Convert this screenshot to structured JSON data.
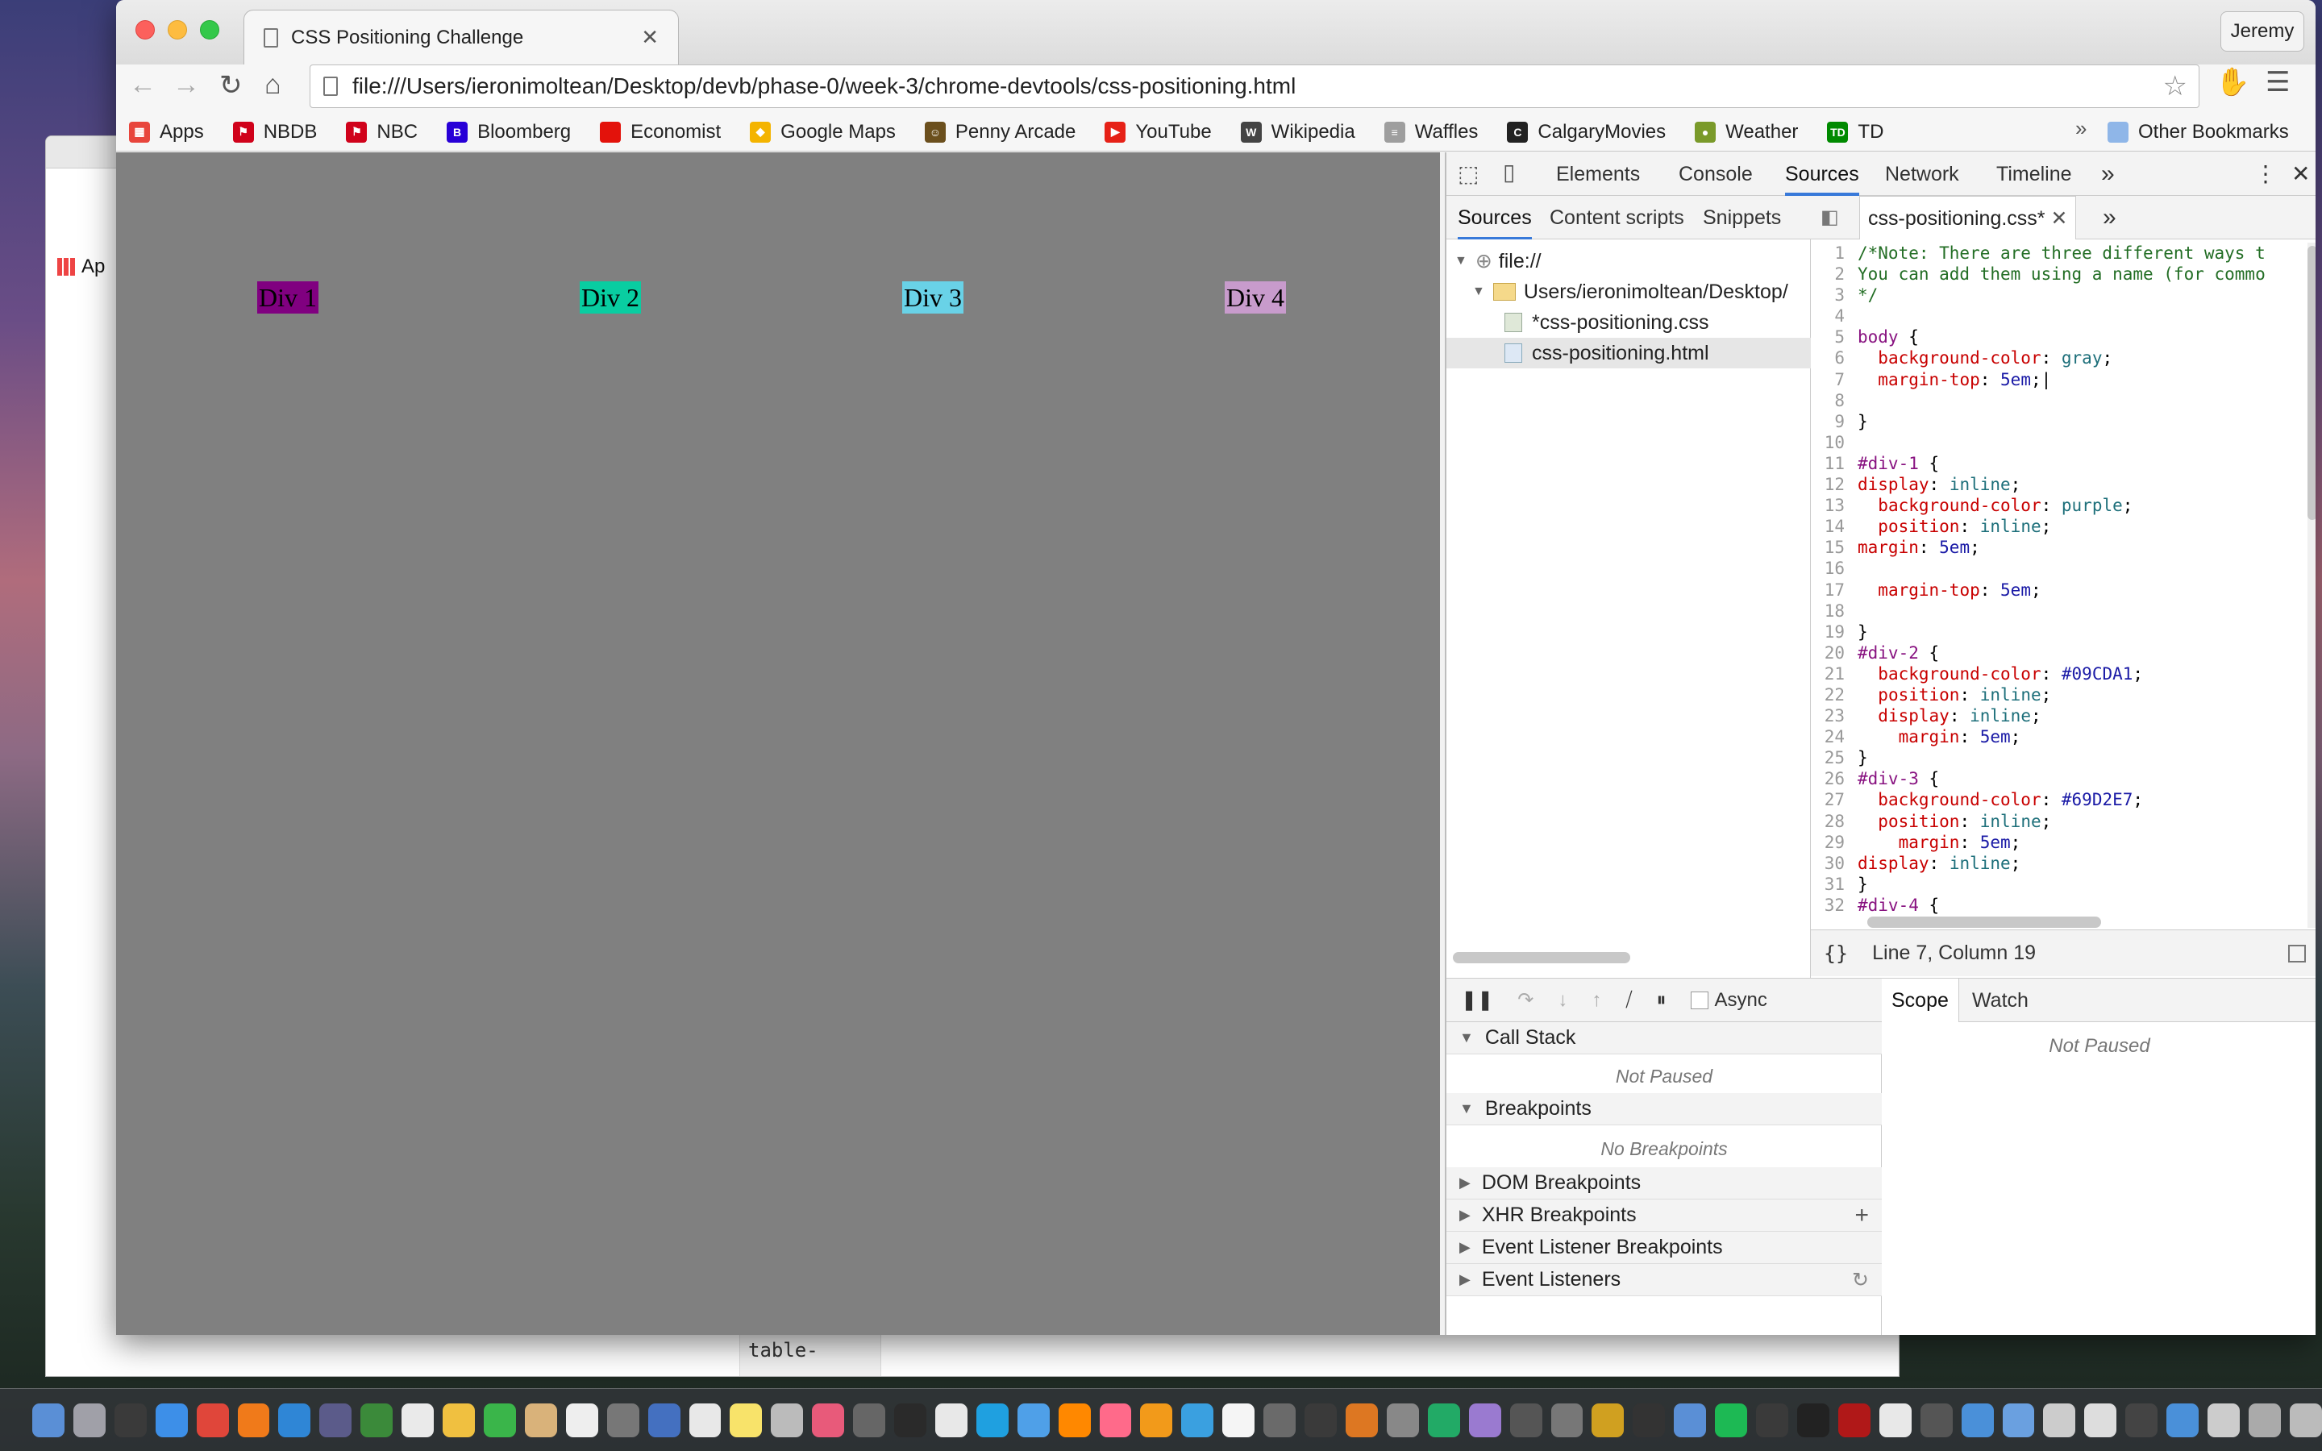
{
  "bg_window": {
    "bookmark_fragment": "Ap",
    "bottom_text": "table-"
  },
  "browser": {
    "tab_title": "CSS Positioning Challenge",
    "user": "Jeremy",
    "url": "file:///Users/ieronimoltean/Desktop/devb/phase-0/week-3/chrome-devtools/css-positioning.html",
    "bookmarks": [
      {
        "label": "Apps",
        "icon": "apps-grid-icon",
        "color": "#e8453c"
      },
      {
        "label": "NBDB",
        "icon": "flag-icon",
        "color": "#d0021b"
      },
      {
        "label": "NBC",
        "icon": "flag-icon",
        "color": "#d0021b"
      },
      {
        "label": "Bloomberg",
        "icon": "b-letter-icon",
        "color": "#2800d7"
      },
      {
        "label": "Economist",
        "icon": "square-icon",
        "color": "#e3120b"
      },
      {
        "label": "Google Maps",
        "icon": "maps-pin-icon",
        "color": "#f4b400"
      },
      {
        "label": "Penny Arcade",
        "icon": "face-icon",
        "color": "#6b4f1d"
      },
      {
        "label": "YouTube",
        "icon": "play-icon",
        "color": "#e62117"
      },
      {
        "label": "Wikipedia",
        "icon": "w-letter-icon",
        "color": "#444444"
      },
      {
        "label": "Waffles",
        "icon": "document-icon",
        "color": "#9e9e9e"
      },
      {
        "label": "CalgaryMovies",
        "icon": "c-letter-icon",
        "color": "#222222"
      },
      {
        "label": "Weather",
        "icon": "globe-icon",
        "color": "#7a9a2a"
      },
      {
        "label": "TD",
        "icon": "td-logo-icon",
        "color": "#008a00"
      }
    ],
    "bookmarks_overflow": "»",
    "other_bookmarks": "Other Bookmarks"
  },
  "page": {
    "divs": [
      {
        "label": "Div 1",
        "color": "#800080"
      },
      {
        "label": "Div 2",
        "color": "#09CDA1"
      },
      {
        "label": "Div 3",
        "color": "#69D2E7"
      },
      {
        "label": "Div 4",
        "color": "#c89bcc"
      }
    ]
  },
  "devtools": {
    "tabs": [
      "Elements",
      "Console",
      "Sources",
      "Network",
      "Timeline"
    ],
    "active_tab": "Sources",
    "more": "»",
    "nav_tabs": [
      "Sources",
      "Content scripts",
      "Snippets"
    ],
    "tree": {
      "root": "file://",
      "folder": "Users/ieronimoltean/Desktop/",
      "files": [
        "*css-positioning.css",
        "css-positioning.html"
      ]
    },
    "editor_tab": "css-positioning.css*",
    "status": "Line 7, Column 19",
    "format_icon": "{}",
    "debugger": {
      "async": "Async",
      "call_stack": "Call Stack",
      "not_paused": "Not Paused",
      "breakpoints": "Breakpoints",
      "no_breakpoints": "No Breakpoints",
      "dom": "DOM Breakpoints",
      "xhr": "XHR Breakpoints",
      "event_listener_bp": "Event Listener Breakpoints",
      "event_listeners": "Event Listeners"
    },
    "scope_tabs": [
      "Scope",
      "Watch"
    ],
    "scope_empty": "Not Paused"
  },
  "code": [
    {
      "n": "1",
      "parts": [
        [
          "cm",
          "/*Note: There are three different ways t"
        ]
      ]
    },
    {
      "n": "2",
      "parts": [
        [
          "cm",
          "You can add them using a name (for commo"
        ]
      ]
    },
    {
      "n": "3",
      "parts": [
        [
          "cm",
          "*/"
        ]
      ]
    },
    {
      "n": "4",
      "parts": []
    },
    {
      "n": "5",
      "parts": [
        [
          "sel",
          "body"
        ],
        [
          "",
          "{"
        ]
      ]
    },
    {
      "n": "6",
      "parts": [
        [
          "",
          "  "
        ],
        [
          "prop",
          "background-color"
        ],
        [
          "",
          ": "
        ],
        [
          "kw",
          "gray"
        ],
        [
          "",
          ";"
        ]
      ]
    },
    {
      "n": "7",
      "parts": [
        [
          "",
          "  "
        ],
        [
          "prop",
          "margin-top"
        ],
        [
          "",
          ": "
        ],
        [
          "val",
          "5em"
        ],
        [
          "",
          ";|"
        ]
      ]
    },
    {
      "n": "8",
      "parts": []
    },
    {
      "n": "9",
      "parts": [
        [
          "",
          "}"
        ]
      ]
    },
    {
      "n": "10",
      "parts": []
    },
    {
      "n": "11",
      "parts": [
        [
          "sel",
          "#div-1"
        ],
        [
          "",
          "{"
        ]
      ]
    },
    {
      "n": "12",
      "parts": [
        [
          "prop",
          "display"
        ],
        [
          "",
          ": "
        ],
        [
          "kw",
          "inline"
        ],
        [
          "",
          ";"
        ]
      ]
    },
    {
      "n": "13",
      "parts": [
        [
          "",
          "  "
        ],
        [
          "prop",
          "background-color"
        ],
        [
          "",
          ": "
        ],
        [
          "kw",
          "purple"
        ],
        [
          "",
          ";"
        ]
      ]
    },
    {
      "n": "14",
      "parts": [
        [
          "",
          "  "
        ],
        [
          "prop",
          "position"
        ],
        [
          "",
          ": "
        ],
        [
          "kw",
          "inline"
        ],
        [
          "",
          ";"
        ]
      ]
    },
    {
      "n": "15",
      "parts": [
        [
          "prop",
          "margin"
        ],
        [
          "",
          ": "
        ],
        [
          "val",
          "5em"
        ],
        [
          "",
          ";"
        ]
      ]
    },
    {
      "n": "16",
      "parts": []
    },
    {
      "n": "17",
      "parts": [
        [
          "",
          "  "
        ],
        [
          "prop",
          "margin-top"
        ],
        [
          "",
          ": "
        ],
        [
          "val",
          "5em"
        ],
        [
          "",
          ";"
        ]
      ]
    },
    {
      "n": "18",
      "parts": []
    },
    {
      "n": "19",
      "parts": [
        [
          "",
          "}"
        ]
      ]
    },
    {
      "n": "20",
      "parts": [
        [
          "sel",
          "#div-2"
        ],
        [
          "",
          "{"
        ]
      ]
    },
    {
      "n": "21",
      "parts": [
        [
          "",
          "  "
        ],
        [
          "prop",
          "background-color"
        ],
        [
          "",
          ": "
        ],
        [
          "val",
          "#09CDA1"
        ],
        [
          "",
          ";"
        ]
      ]
    },
    {
      "n": "22",
      "parts": [
        [
          "",
          "  "
        ],
        [
          "prop",
          "position"
        ],
        [
          "",
          ": "
        ],
        [
          "kw",
          "inline"
        ],
        [
          "",
          ";"
        ]
      ]
    },
    {
      "n": "23",
      "parts": [
        [
          "",
          "  "
        ],
        [
          "prop",
          "display"
        ],
        [
          "",
          ": "
        ],
        [
          "kw",
          "inline"
        ],
        [
          "",
          ";"
        ]
      ]
    },
    {
      "n": "24",
      "parts": [
        [
          "",
          "    "
        ],
        [
          "prop",
          "margin"
        ],
        [
          "",
          ": "
        ],
        [
          "val",
          "5em"
        ],
        [
          "",
          ";"
        ]
      ]
    },
    {
      "n": "25",
      "parts": [
        [
          "",
          "}"
        ]
      ]
    },
    {
      "n": "26",
      "parts": [
        [
          "sel",
          "#div-3"
        ],
        [
          "",
          "{"
        ]
      ]
    },
    {
      "n": "27",
      "parts": [
        [
          "",
          "  "
        ],
        [
          "prop",
          "background-color"
        ],
        [
          "",
          ": "
        ],
        [
          "val",
          "#69D2E7"
        ],
        [
          "",
          ";"
        ]
      ]
    },
    {
      "n": "28",
      "parts": [
        [
          "",
          "  "
        ],
        [
          "prop",
          "position"
        ],
        [
          "",
          ": "
        ],
        [
          "kw",
          "inline"
        ],
        [
          "",
          ";"
        ]
      ]
    },
    {
      "n": "29",
      "parts": [
        [
          "",
          "    "
        ],
        [
          "prop",
          "margin"
        ],
        [
          "",
          ": "
        ],
        [
          "val",
          "5em"
        ],
        [
          "",
          ";"
        ]
      ]
    },
    {
      "n": "30",
      "parts": [
        [
          "",
          ""
        ],
        [
          "prop",
          "display"
        ],
        [
          "",
          ": "
        ],
        [
          "kw",
          "inline"
        ],
        [
          "",
          ";"
        ]
      ]
    },
    {
      "n": "31",
      "parts": [
        [
          "",
          "}"
        ]
      ]
    },
    {
      "n": "32",
      "parts": [
        [
          "sel",
          "#div-4"
        ],
        [
          "",
          "{"
        ]
      ]
    },
    {
      "n": "33",
      "parts": []
    }
  ],
  "dock": {
    "icon_colors": [
      "#5a8fd6",
      "#a0a0a8",
      "#3a3a3a",
      "#3d8fe8",
      "#e0463a",
      "#f07a1a",
      "#2f86d6",
      "#5b5b8a",
      "#3b8a3a",
      "#eaeaea",
      "#f0c040",
      "#3ab54a",
      "#d9b27a",
      "#eeeeee",
      "#777777",
      "#4470c0",
      "#e8e8e8",
      "#f8e36a",
      "#bbbbbb",
      "#e85a7a",
      "#666666",
      "#2a2a2a",
      "#e8e8e8",
      "#1fa0e0",
      "#4fa0e8",
      "#ff8800",
      "#ff6a8a",
      "#f29a1a",
      "#3aa0e0",
      "#f5f5f5",
      "#6a6a6a",
      "#3a3a3a",
      "#dd7722",
      "#888888",
      "#2a6",
      "#9a7ad0",
      "#555555",
      "#777777",
      "#d0a020",
      "#333333",
      "#5a8fd6",
      "#1db954",
      "#3a3a3a",
      "#222222",
      "#b01818",
      "#e8e8e8",
      "#555555",
      "#4a90d9",
      "#6aa0e0",
      "#cccccc",
      "#dddddd",
      "#444444",
      "#4a90d9",
      "#cccccc",
      "#aaaaaa",
      "#bbbbbb"
    ]
  }
}
